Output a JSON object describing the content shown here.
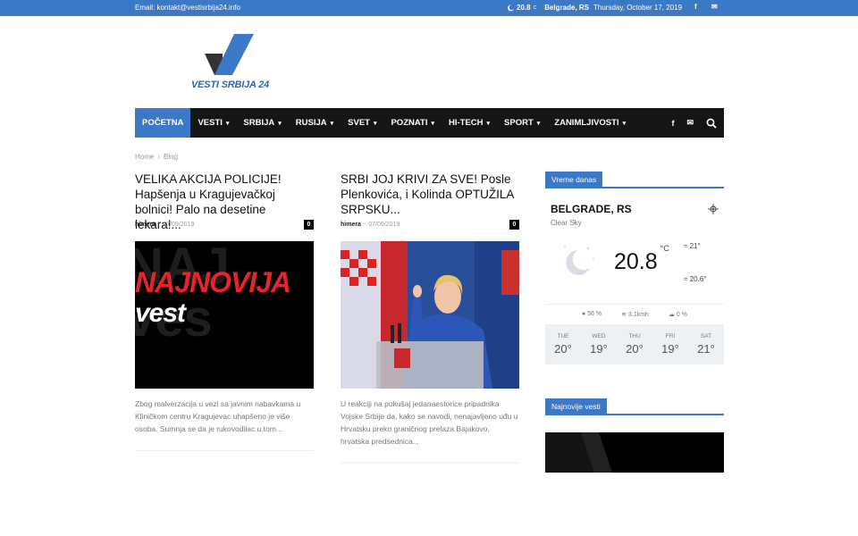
{
  "topbar": {
    "email": "Email: kontakt@vestisrbija24.info",
    "weather_temp": "20.8",
    "weather_unit": "C",
    "weather_city": "Belgrade, RS",
    "date": "Thursday, October 17, 2019",
    "social": [
      "f",
      "✉"
    ]
  },
  "logo": {
    "text": "VESTI SRBIJA 24",
    "brand_color": "#2e66b5"
  },
  "nav": {
    "items": [
      {
        "label": "POČETNA",
        "active": true,
        "dropdown": false
      },
      {
        "label": "VESTI",
        "dropdown": true
      },
      {
        "label": "SRBIJA",
        "dropdown": true
      },
      {
        "label": "RUSIJA",
        "dropdown": true
      },
      {
        "label": "SVET",
        "dropdown": true
      },
      {
        "label": "POZNATI",
        "dropdown": true
      },
      {
        "label": "HI-TECH",
        "dropdown": true
      },
      {
        "label": "SPORT",
        "dropdown": true
      },
      {
        "label": "ZANIMLJIVOSTI",
        "dropdown": true
      }
    ],
    "right_icons": [
      "facebook-icon",
      "mail-icon",
      "search-icon"
    ]
  },
  "breadcrumb": {
    "home": "Home",
    "separator": "›",
    "current": "Blog"
  },
  "articles": [
    {
      "title": "VELIKA AKCIJA POLICIJE! Hapšenja u Kragujevačkoj bolnici! Palo na desetine lekara!...",
      "author": "himera",
      "date": "17/09/2019",
      "comments": "0",
      "thumb_text_1": "NAJNOVIJA",
      "thumb_text_2": "vest",
      "excerpt": "Zbog malverzacija u vezi sa javnim nabavkama u Kliničkom centru Kragujevac uhapšeno je više osoba. Sumnja se da je rukovodilac u tom..."
    },
    {
      "title": "SRBI JOJ KRIVI ZA SVE! Posle Plenkovića, i Kolinda OPTUŽILA SRPSKU...",
      "author": "himera",
      "date": "07/09/2019",
      "comments": "0",
      "excerpt": "U reakciji na pokušaj jedanaestorice pripadnika Vojske Srbije da, kako se navodi, nenajavljeno uđu u Hrvatsku preko graničnog prelaza Bajakovo, hrvatska predsednica..."
    }
  ],
  "sidebar": {
    "weather_block_title": "Vreme danas",
    "weather": {
      "city": "BELGRADE, RS",
      "description": "Clear Sky",
      "temp": "20.8",
      "unit": "C",
      "high": "21°",
      "low": "20.6°",
      "humidity": "56 %",
      "wind": "3.1kmh",
      "clouds": "0 %",
      "forecast": [
        {
          "day": "TUE",
          "temp": "20°"
        },
        {
          "day": "WED",
          "temp": "19°"
        },
        {
          "day": "THU",
          "temp": "20°"
        },
        {
          "day": "FRI",
          "temp": "19°"
        },
        {
          "day": "SAT",
          "temp": "21°"
        }
      ]
    },
    "news_block_title": "Najnovije vesti"
  },
  "colors": {
    "accent": "#3b78c6",
    "nav_bg": "#151515",
    "thumb_red": "#e8242a"
  }
}
